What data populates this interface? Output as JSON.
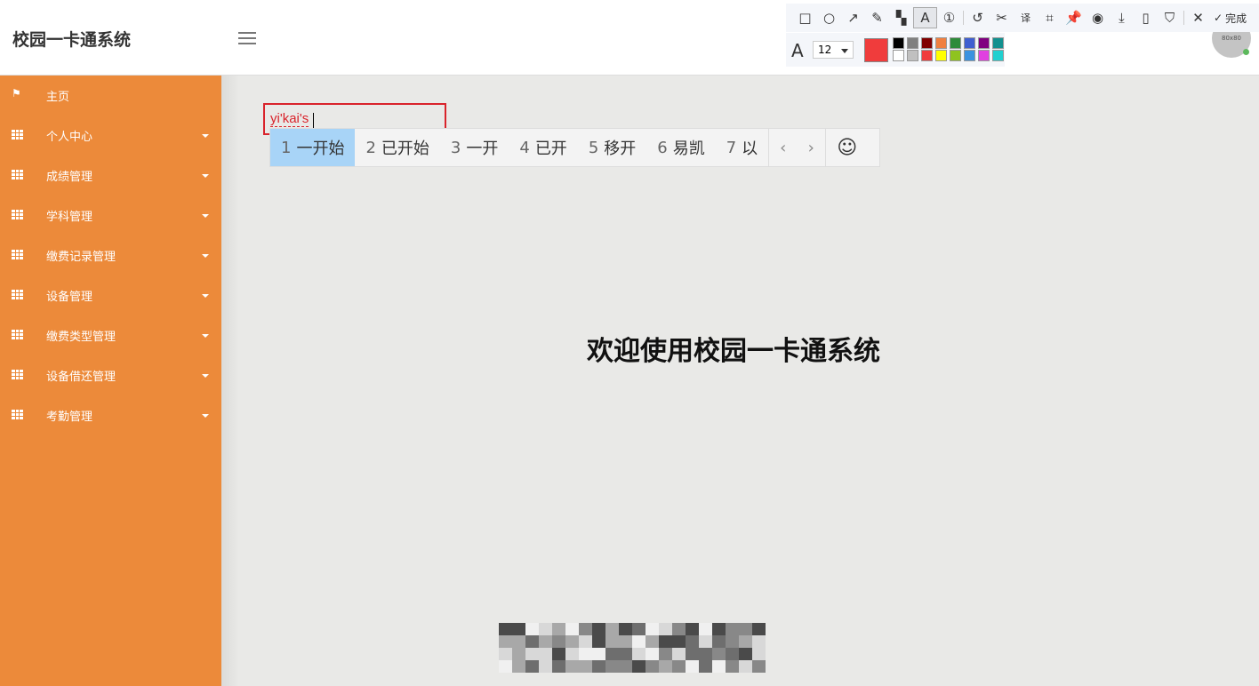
{
  "header": {
    "title": "校园一卡通系统",
    "avatar_text": "80x80"
  },
  "sidebar": {
    "items": [
      {
        "label": "主页",
        "icon": "flag-icon",
        "expandable": false
      },
      {
        "label": "个人中心",
        "icon": "grid-icon",
        "expandable": true
      },
      {
        "label": "成绩管理",
        "icon": "grid-icon",
        "expandable": true
      },
      {
        "label": "学科管理",
        "icon": "grid-icon",
        "expandable": true
      },
      {
        "label": "缴费记录管理",
        "icon": "grid-icon",
        "expandable": true
      },
      {
        "label": "设备管理",
        "icon": "grid-icon",
        "expandable": true
      },
      {
        "label": "缴费类型管理",
        "icon": "grid-icon",
        "expandable": true
      },
      {
        "label": "设备借还管理",
        "icon": "grid-icon",
        "expandable": true
      },
      {
        "label": "考勤管理",
        "icon": "grid-icon",
        "expandable": true
      }
    ]
  },
  "main": {
    "welcome": "欢迎使用校园一卡通系统"
  },
  "annotation": {
    "text_input": "yi'kai's",
    "font_size": "12",
    "current_color": "#f03c3c",
    "palette": [
      "#000000",
      "#808080",
      "#800000",
      "#f08040",
      "#2e8b3a",
      "#3f5fd0",
      "#800080",
      "#12908f",
      "#ffffff",
      "#c0c0c0",
      "#f03c3c",
      "#ffff00",
      "#8fc31f",
      "#3a92e0",
      "#e040e0",
      "#20d0d0"
    ],
    "done_label": "完成"
  },
  "ime": {
    "candidates": [
      {
        "n": "1",
        "t": "一开始"
      },
      {
        "n": "2",
        "t": "已开始"
      },
      {
        "n": "3",
        "t": "一开"
      },
      {
        "n": "4",
        "t": "已开"
      },
      {
        "n": "5",
        "t": "移开"
      },
      {
        "n": "6",
        "t": "易凯"
      },
      {
        "n": "7",
        "t": "以"
      }
    ],
    "prev": "‹",
    "next": "›",
    "emoji": "☺"
  },
  "tools": [
    {
      "name": "rectangle-icon",
      "g": "□"
    },
    {
      "name": "circle-icon",
      "g": "○"
    },
    {
      "name": "arrow-icon",
      "g": "↗"
    },
    {
      "name": "pencil-icon",
      "g": "✎"
    },
    {
      "name": "mosaic-icon",
      "g": "▚"
    },
    {
      "name": "text-icon",
      "g": "A"
    },
    {
      "name": "number-icon",
      "g": "①"
    },
    {
      "name": "undo-icon",
      "g": "↺"
    },
    {
      "name": "cut-icon",
      "g": "✂"
    },
    {
      "name": "translate-icon",
      "g": "译"
    },
    {
      "name": "ocr-icon",
      "g": "⌗"
    },
    {
      "name": "pin-icon",
      "g": "📌"
    },
    {
      "name": "record-icon",
      "g": "◉"
    },
    {
      "name": "download-icon",
      "g": "⤓"
    },
    {
      "name": "phone-icon",
      "g": "▯"
    },
    {
      "name": "bookmark-icon",
      "g": "⛉"
    },
    {
      "name": "close-icon",
      "g": "✕"
    }
  ]
}
